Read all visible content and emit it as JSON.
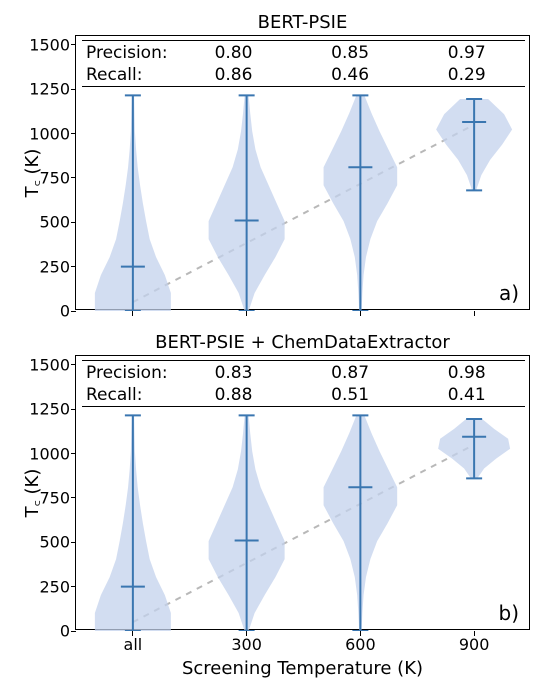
{
  "chart_data": [
    {
      "type": "violin",
      "title": "BERT-PSIE",
      "panel_label": "a)",
      "ylabel": "T꜀ (K)",
      "xlabel": "Screening Temperature (K)",
      "ylim": [
        0,
        1550
      ],
      "yticks": [
        0,
        250,
        500,
        750,
        1000,
        1250,
        1500
      ],
      "categories": [
        "all",
        "300",
        "600",
        "900"
      ],
      "stats_header": [
        "Precision:",
        "Recall:"
      ],
      "precision": [
        "0.80",
        "0.85",
        "0.97"
      ],
      "recall": [
        "0.86",
        "0.46",
        "0.29"
      ],
      "violins": [
        {
          "x": "all",
          "min": 0,
          "max": 1215,
          "median": 250,
          "profile": [
            0.95,
            0.95,
            0.8,
            0.58,
            0.42,
            0.33,
            0.25,
            0.18,
            0.12,
            0.08,
            0.05,
            0.04,
            0.03
          ]
        },
        {
          "x": "300",
          "min": 0,
          "max": 1215,
          "median": 510,
          "profile": [
            0.05,
            0.2,
            0.45,
            0.72,
            0.95,
            0.95,
            0.75,
            0.55,
            0.35,
            0.22,
            0.14,
            0.09,
            0.05
          ]
        },
        {
          "x": "600",
          "min": 0,
          "max": 1215,
          "median": 810,
          "profile": [
            0.03,
            0.05,
            0.08,
            0.14,
            0.25,
            0.42,
            0.68,
            0.92,
            0.92,
            0.7,
            0.48,
            0.28,
            0.1
          ]
        },
        {
          "x": "900",
          "min": 680,
          "max": 1195,
          "median": 1065,
          "profile": [
            0.05,
            0.18,
            0.4,
            0.7,
            0.95,
            0.75,
            0.35
          ]
        }
      ],
      "dashed_line": {
        "y_at_all": 50,
        "y_at_900": 1050
      }
    },
    {
      "type": "violin",
      "title": "BERT-PSIE + ChemDataExtractor",
      "panel_label": "b)",
      "ylabel": "T꜀ (K)",
      "xlabel": "Screening Temperature (K)",
      "ylim": [
        0,
        1550
      ],
      "yticks": [
        0,
        250,
        500,
        750,
        1000,
        1250,
        1500
      ],
      "categories": [
        "all",
        "300",
        "600",
        "900"
      ],
      "stats_header": [
        "Precision:",
        "Recall:"
      ],
      "precision": [
        "0.83",
        "0.87",
        "0.98"
      ],
      "recall": [
        "0.88",
        "0.51",
        "0.41"
      ],
      "violins": [
        {
          "x": "all",
          "min": 0,
          "max": 1215,
          "median": 250,
          "profile": [
            0.95,
            0.95,
            0.8,
            0.58,
            0.42,
            0.33,
            0.25,
            0.18,
            0.12,
            0.08,
            0.05,
            0.04,
            0.03
          ]
        },
        {
          "x": "300",
          "min": 0,
          "max": 1215,
          "median": 510,
          "profile": [
            0.05,
            0.2,
            0.45,
            0.72,
            0.95,
            0.95,
            0.75,
            0.55,
            0.35,
            0.22,
            0.14,
            0.09,
            0.05
          ]
        },
        {
          "x": "600",
          "min": 0,
          "max": 1215,
          "median": 810,
          "profile": [
            0.03,
            0.05,
            0.08,
            0.14,
            0.25,
            0.42,
            0.68,
            0.92,
            0.92,
            0.7,
            0.48,
            0.28,
            0.1
          ]
        },
        {
          "x": "900",
          "min": 860,
          "max": 1195,
          "median": 1095,
          "profile": [
            0.08,
            0.25,
            0.55,
            0.9,
            0.85,
            0.5,
            0.2
          ]
        }
      ],
      "dashed_line": {
        "y_at_all": 50,
        "y_at_900": 1050
      }
    }
  ]
}
